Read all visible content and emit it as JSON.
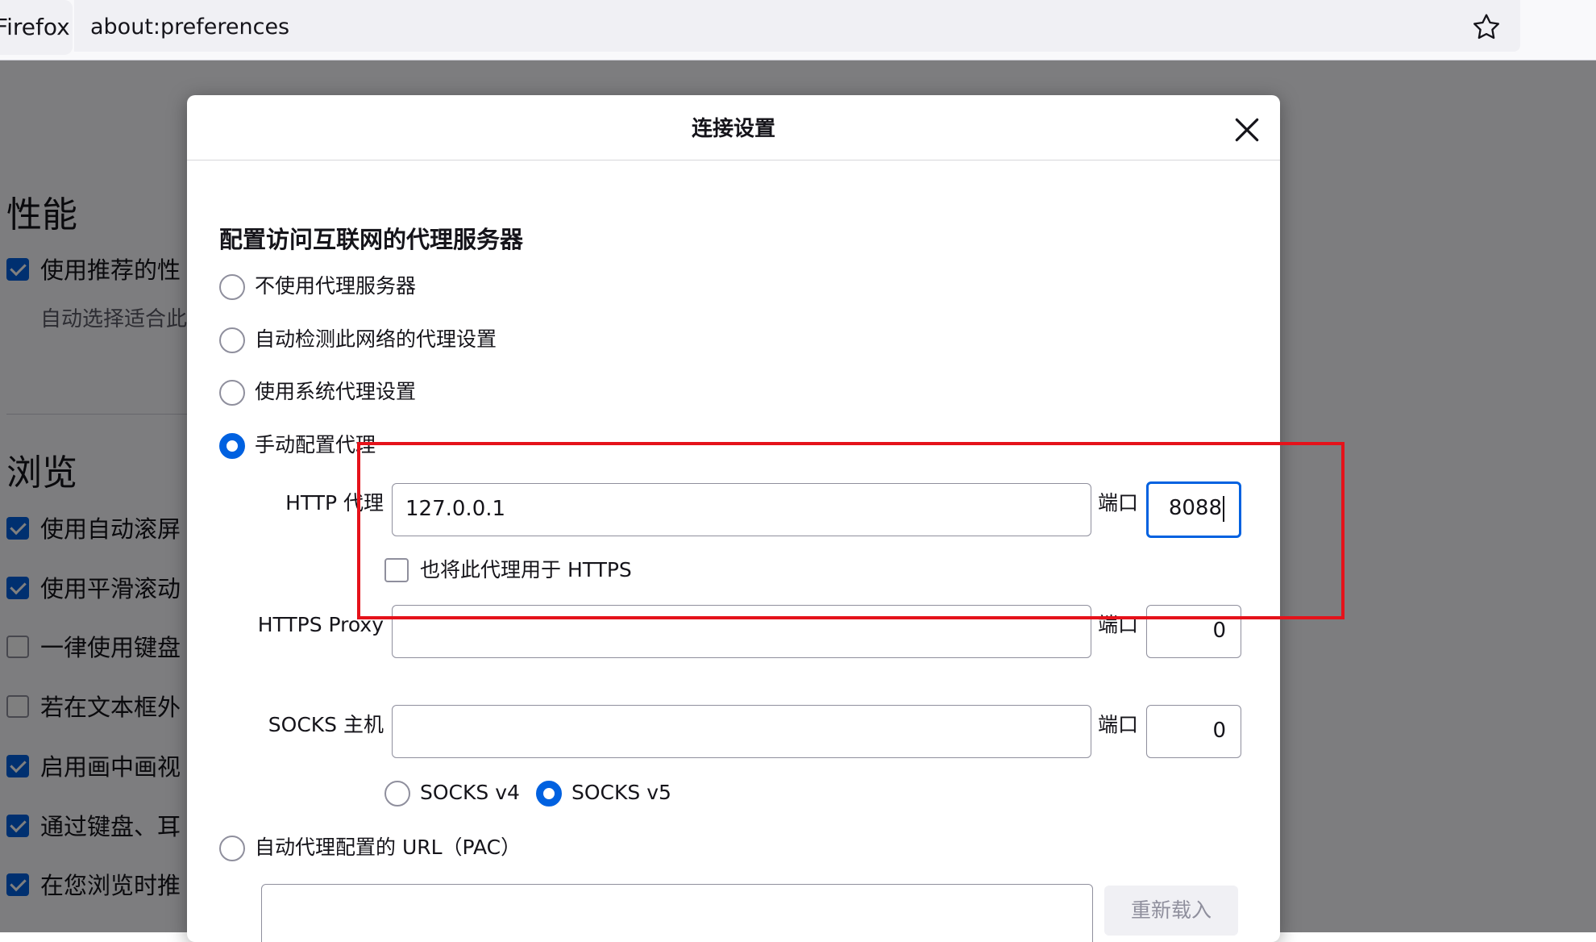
{
  "browser": {
    "identity_label": "Firefox",
    "url": "about:preferences",
    "bookmark_icon": "star-icon"
  },
  "background_prefs": {
    "performance_heading": "性能",
    "performance_items": [
      {
        "label": "使用推荐的性",
        "checked": true
      }
    ],
    "performance_sub": "自动选择适合此",
    "browsing_heading": "浏览",
    "browsing_items": [
      {
        "label": "使用自动滚屏",
        "checked": true
      },
      {
        "label": "使用平滑滚动",
        "checked": true
      },
      {
        "label": "一律使用键盘",
        "checked": false
      },
      {
        "label": "若在文本框外",
        "checked": false
      },
      {
        "label": "启用画中画视",
        "checked": true
      },
      {
        "label": "通过键盘、耳",
        "checked": true
      },
      {
        "label": "在您浏览时推",
        "checked": true
      }
    ]
  },
  "dialog": {
    "title": "连接设置",
    "close_icon": "close-icon",
    "section_heading": "配置访问互联网的代理服务器",
    "proxy_options": [
      {
        "label": "不使用代理服务器",
        "selected": false
      },
      {
        "label": "自动检测此网络的代理设置",
        "selected": false
      },
      {
        "label": "使用系统代理设置",
        "selected": false
      },
      {
        "label": "手动配置代理",
        "selected": true
      }
    ],
    "http_proxy": {
      "label": "HTTP 代理",
      "value": "127.0.0.1",
      "port_label": "端口",
      "port": "8088"
    },
    "use_for_https": {
      "label": "也将此代理用于 HTTPS",
      "checked": false
    },
    "https_proxy": {
      "label": "HTTPS Proxy",
      "value": "",
      "port_label": "端口",
      "port": "0"
    },
    "socks_host": {
      "label": "SOCKS 主机",
      "value": "",
      "port_label": "端口",
      "port": "0"
    },
    "socks_versions": [
      {
        "label": "SOCKS v4",
        "selected": false
      },
      {
        "label": "SOCKS v5",
        "selected": true
      }
    ],
    "pac": {
      "label": "自动代理配置的 URL（PAC）",
      "selected": false,
      "value": "",
      "reload_label": "重新载入"
    }
  }
}
